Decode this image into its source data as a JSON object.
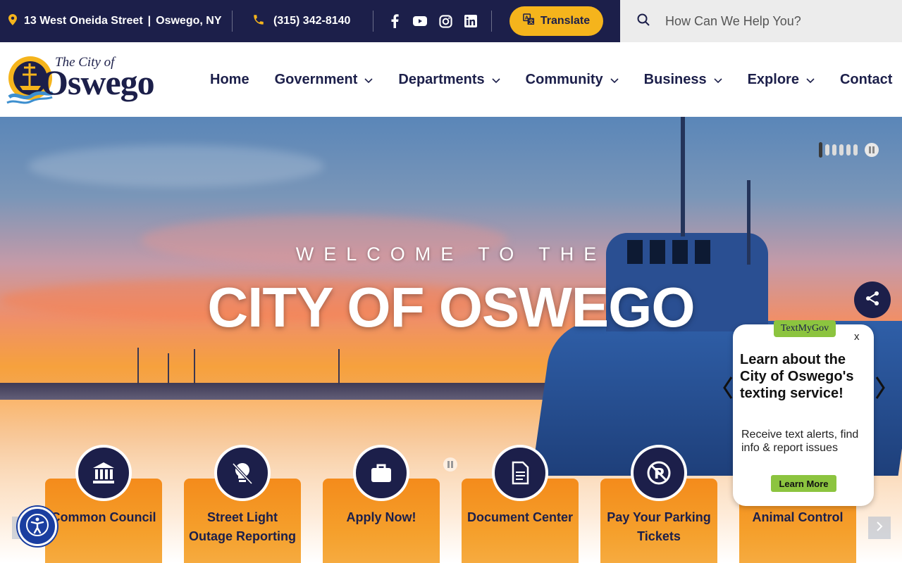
{
  "topbar": {
    "address_street": "13 West Oneida Street",
    "address_separator": "|",
    "address_city": "Oswego, NY",
    "phone": "(315) 342-8140",
    "translate_label": "Translate",
    "search_placeholder": "How Can We Help You?",
    "social_icons": [
      "facebook-icon",
      "youtube-icon",
      "instagram-icon",
      "linkedin-icon"
    ]
  },
  "logo": {
    "small_text": "The City of",
    "big_text": "Oswego"
  },
  "nav": {
    "items": [
      {
        "label": "Home",
        "has_dropdown": false
      },
      {
        "label": "Government",
        "has_dropdown": true
      },
      {
        "label": "Departments",
        "has_dropdown": true
      },
      {
        "label": "Community",
        "has_dropdown": true
      },
      {
        "label": "Business",
        "has_dropdown": true
      },
      {
        "label": "Explore",
        "has_dropdown": true
      },
      {
        "label": "Contact",
        "has_dropdown": false
      }
    ]
  },
  "hero": {
    "eyebrow": "WELCOME TO THE",
    "title": "CITY OF OSWEGO"
  },
  "quick_links": [
    {
      "label": "Common Council",
      "icon": "government-building-icon"
    },
    {
      "label": "Street Light Outage Reporting",
      "icon": "lightbulb-off-icon"
    },
    {
      "label": "Apply Now!",
      "icon": "briefcase-icon"
    },
    {
      "label": "Document Center",
      "icon": "document-icon"
    },
    {
      "label": "Pay Your Parking Tickets",
      "icon": "no-parking-icon"
    },
    {
      "label": "Animal Control",
      "icon": "animal-icon"
    }
  ],
  "textmygov": {
    "badge": "TextMyGov",
    "close": "x",
    "title": "Learn about the City of Oswego's texting service!",
    "body": "Receive text alerts, find info & report issues",
    "button": "Learn More"
  },
  "colors": {
    "navy": "#1c1f4a",
    "gold": "#f5b41c",
    "orange": "#f48b1b",
    "green": "#8cc43f",
    "accessibility_blue": "#1a3ea0"
  }
}
